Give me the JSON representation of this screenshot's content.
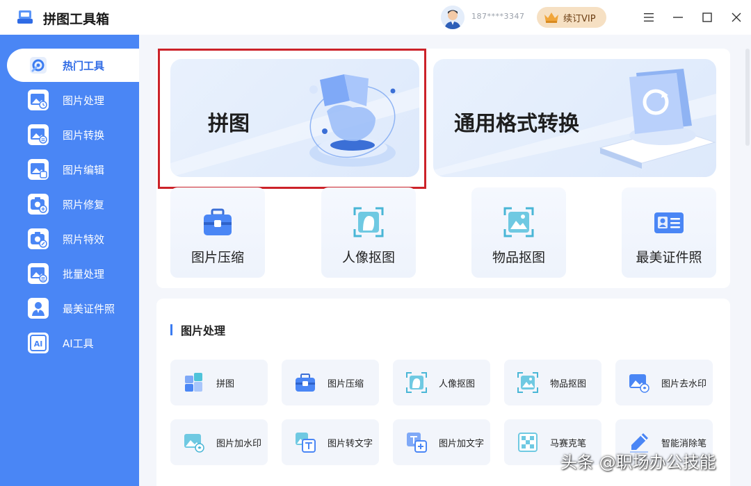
{
  "app": {
    "title": "拼图工具箱"
  },
  "user": {
    "name": "187****3347"
  },
  "vip": {
    "label": "续订VIP"
  },
  "colors": {
    "sidebar": "#4a86f5",
    "accent": "#2f6be5",
    "highlight": "#cc2229",
    "vip_bg": "#f6e0c3"
  },
  "sidebar": {
    "items": [
      {
        "label": "热门工具",
        "icon": "wrench-gear-icon",
        "active": true
      },
      {
        "label": "图片处理",
        "icon": "image-clock-icon"
      },
      {
        "label": "图片转换",
        "icon": "image-convert-icon"
      },
      {
        "label": "图片编辑",
        "icon": "image-edit-icon"
      },
      {
        "label": "照片修复",
        "icon": "camera-plus-icon"
      },
      {
        "label": "照片特效",
        "icon": "camera-magic-icon"
      },
      {
        "label": "批量处理",
        "icon": "image-batch-icon"
      },
      {
        "label": "最美证件照",
        "icon": "id-photo-icon"
      },
      {
        "label": "AI工具",
        "icon": "ai-icon"
      }
    ]
  },
  "banners": [
    {
      "title": "拼图",
      "icon": "puzzle-illustration"
    },
    {
      "title": "通用格式转换",
      "icon": "convert-illustration"
    }
  ],
  "tools": [
    {
      "label": "图片压缩",
      "icon": "briefcase-icon"
    },
    {
      "label": "人像抠图",
      "icon": "portrait-cutout-icon"
    },
    {
      "label": "物品抠图",
      "icon": "object-cutout-icon"
    },
    {
      "label": "最美证件照",
      "icon": "id-card-icon"
    }
  ],
  "section": {
    "title": "图片处理",
    "items": [
      {
        "label": "拼图",
        "icon": "puzzle-icon"
      },
      {
        "label": "图片压缩",
        "icon": "briefcase-icon"
      },
      {
        "label": "人像抠图",
        "icon": "portrait-cutout-icon"
      },
      {
        "label": "物品抠图",
        "icon": "object-cutout-icon"
      },
      {
        "label": "图片去水印",
        "icon": "remove-watermark-icon"
      },
      {
        "label": "图片加水印",
        "icon": "add-watermark-icon"
      },
      {
        "label": "图片转文字",
        "icon": "image-to-text-icon"
      },
      {
        "label": "图片加文字",
        "icon": "add-text-icon"
      },
      {
        "label": "马赛克笔",
        "icon": "mosaic-icon"
      },
      {
        "label": "智能消除笔",
        "icon": "eraser-pen-icon"
      }
    ]
  },
  "watermark": {
    "text": "头条 @职场办公技能"
  }
}
